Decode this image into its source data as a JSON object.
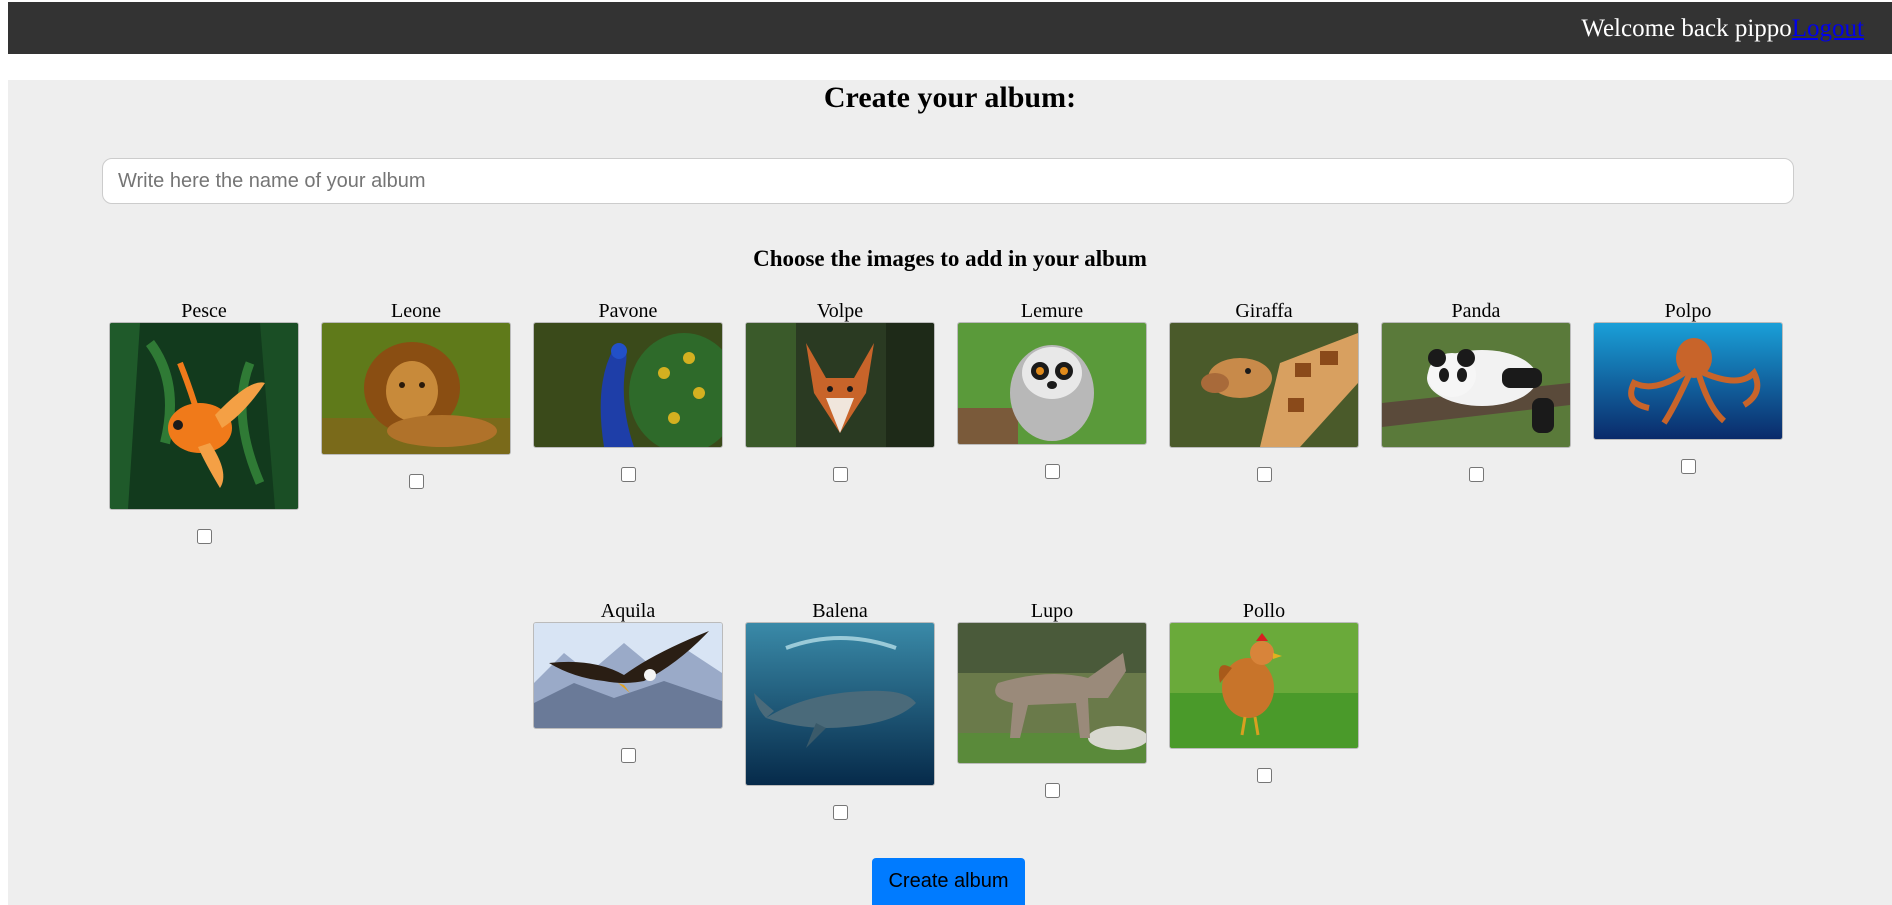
{
  "header": {
    "welcome_text": "Welcome back pippo",
    "logout_label": "Logout"
  },
  "main": {
    "title": "Create your album:",
    "album_input": {
      "placeholder": "Write here the name of your album",
      "value": ""
    },
    "choose_title": "Choose the images to add in your album",
    "images": [
      {
        "name": "Pesce",
        "checked": false,
        "icon": "goldfish-photo"
      },
      {
        "name": "Leone",
        "checked": false,
        "icon": "lion-photo"
      },
      {
        "name": "Pavone",
        "checked": false,
        "icon": "peacock-photo"
      },
      {
        "name": "Volpe",
        "checked": false,
        "icon": "fox-photo"
      },
      {
        "name": "Lemure",
        "checked": false,
        "icon": "lemur-photo"
      },
      {
        "name": "Giraffa",
        "checked": false,
        "icon": "giraffe-photo"
      },
      {
        "name": "Panda",
        "checked": false,
        "icon": "panda-photo"
      },
      {
        "name": "Polpo",
        "checked": false,
        "icon": "octopus-photo"
      },
      {
        "name": "Aquila",
        "checked": false,
        "icon": "eagle-photo"
      },
      {
        "name": "Balena",
        "checked": false,
        "icon": "whale-photo"
      },
      {
        "name": "Lupo",
        "checked": false,
        "icon": "wolf-photo"
      },
      {
        "name": "Pollo",
        "checked": false,
        "icon": "chicken-photo"
      }
    ],
    "create_button_label": "Create album"
  },
  "colors": {
    "topbar": "#333333",
    "main_bg": "#eeeeee",
    "button": "#007bff",
    "link": "#0000ee"
  }
}
